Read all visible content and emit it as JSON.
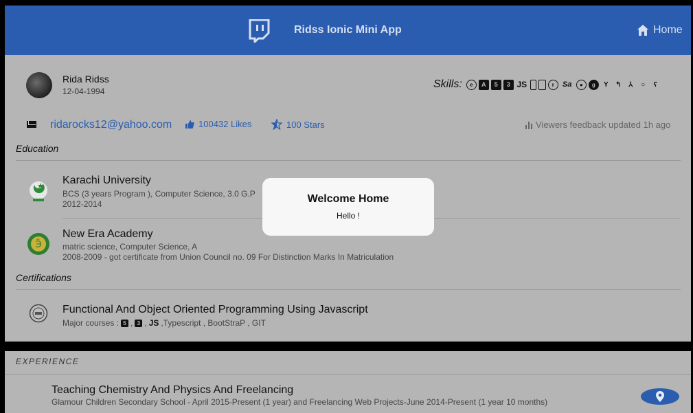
{
  "header": {
    "title": "Ridss Ionic Mini App",
    "home_label": "Home"
  },
  "profile": {
    "name": "Rida Ridss",
    "dob": "12-04-1994"
  },
  "skills": {
    "label": "Skills:",
    "icons": [
      "ember-icon",
      "angular-icon",
      "html5-icon",
      "css3-icon",
      "javascript-icon",
      "mobile-icon",
      "tablet-icon",
      "reddit-icon",
      "sass-icon",
      "circle-target-icon",
      "github-icon",
      "git-branch-icon",
      "git-pull-icon",
      "git-merge-icon",
      "git-commit-icon",
      "git-compare-icon"
    ]
  },
  "contact": {
    "email": "ridarocks12@yahoo.com",
    "likes": "100432 Likes",
    "stars": "100 Stars",
    "feedback": "Viewers feedback updated 1h ago"
  },
  "education": {
    "title": "Education",
    "items": [
      {
        "name": "Karachi University",
        "detail": "BCS (3 years Program ), Computer Science, 3.0 G.P",
        "years": "2012-2014"
      },
      {
        "name": "New Era Academy",
        "detail": "matric science, Computer Science, A",
        "years": "2008-2009 - got certificate from Union Council no. 09 For Distinction Marks In Matriculation"
      }
    ]
  },
  "certifications": {
    "title": "Certifications",
    "items": [
      {
        "name": "Functional And Object Oriented Programming Using Javascript",
        "courses_prefix": "Major courses :",
        "courses_suffix": ",Typescript , BootStraP , GIT"
      }
    ]
  },
  "experience": {
    "title": "EXPERIENCE",
    "items": [
      {
        "title": "Teaching Chemistry And Physics And Freelancing",
        "detail": "Glamour Children Secondary School - April 2015-Present (1 year) and Freelancing Web Projects-June 2014-Present (1 year 10 months)"
      }
    ]
  },
  "modal": {
    "title": "Welcome Home",
    "message": "Hello !"
  },
  "colors": {
    "header": "#2a5db0",
    "backdrop": "#b5b5b5",
    "link": "#2a5db0"
  }
}
